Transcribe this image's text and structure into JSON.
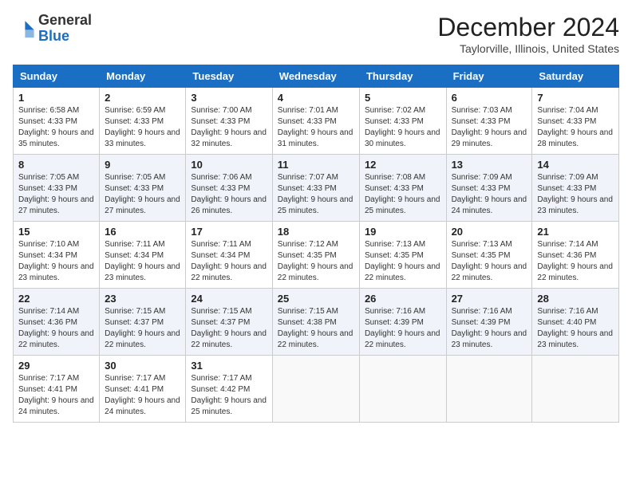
{
  "header": {
    "logo_general": "General",
    "logo_blue": "Blue",
    "month_title": "December 2024",
    "location": "Taylorville, Illinois, United States"
  },
  "days_of_week": [
    "Sunday",
    "Monday",
    "Tuesday",
    "Wednesday",
    "Thursday",
    "Friday",
    "Saturday"
  ],
  "weeks": [
    [
      {
        "day": "1",
        "sunrise": "6:58 AM",
        "sunset": "4:33 PM",
        "daylight": "9 hours and 35 minutes."
      },
      {
        "day": "2",
        "sunrise": "6:59 AM",
        "sunset": "4:33 PM",
        "daylight": "9 hours and 33 minutes."
      },
      {
        "day": "3",
        "sunrise": "7:00 AM",
        "sunset": "4:33 PM",
        "daylight": "9 hours and 32 minutes."
      },
      {
        "day": "4",
        "sunrise": "7:01 AM",
        "sunset": "4:33 PM",
        "daylight": "9 hours and 31 minutes."
      },
      {
        "day": "5",
        "sunrise": "7:02 AM",
        "sunset": "4:33 PM",
        "daylight": "9 hours and 30 minutes."
      },
      {
        "day": "6",
        "sunrise": "7:03 AM",
        "sunset": "4:33 PM",
        "daylight": "9 hours and 29 minutes."
      },
      {
        "day": "7",
        "sunrise": "7:04 AM",
        "sunset": "4:33 PM",
        "daylight": "9 hours and 28 minutes."
      }
    ],
    [
      {
        "day": "8",
        "sunrise": "7:05 AM",
        "sunset": "4:33 PM",
        "daylight": "9 hours and 27 minutes."
      },
      {
        "day": "9",
        "sunrise": "7:05 AM",
        "sunset": "4:33 PM",
        "daylight": "9 hours and 27 minutes."
      },
      {
        "day": "10",
        "sunrise": "7:06 AM",
        "sunset": "4:33 PM",
        "daylight": "9 hours and 26 minutes."
      },
      {
        "day": "11",
        "sunrise": "7:07 AM",
        "sunset": "4:33 PM",
        "daylight": "9 hours and 25 minutes."
      },
      {
        "day": "12",
        "sunrise": "7:08 AM",
        "sunset": "4:33 PM",
        "daylight": "9 hours and 25 minutes."
      },
      {
        "day": "13",
        "sunrise": "7:09 AM",
        "sunset": "4:33 PM",
        "daylight": "9 hours and 24 minutes."
      },
      {
        "day": "14",
        "sunrise": "7:09 AM",
        "sunset": "4:33 PM",
        "daylight": "9 hours and 23 minutes."
      }
    ],
    [
      {
        "day": "15",
        "sunrise": "7:10 AM",
        "sunset": "4:34 PM",
        "daylight": "9 hours and 23 minutes."
      },
      {
        "day": "16",
        "sunrise": "7:11 AM",
        "sunset": "4:34 PM",
        "daylight": "9 hours and 23 minutes."
      },
      {
        "day": "17",
        "sunrise": "7:11 AM",
        "sunset": "4:34 PM",
        "daylight": "9 hours and 22 minutes."
      },
      {
        "day": "18",
        "sunrise": "7:12 AM",
        "sunset": "4:35 PM",
        "daylight": "9 hours and 22 minutes."
      },
      {
        "day": "19",
        "sunrise": "7:13 AM",
        "sunset": "4:35 PM",
        "daylight": "9 hours and 22 minutes."
      },
      {
        "day": "20",
        "sunrise": "7:13 AM",
        "sunset": "4:35 PM",
        "daylight": "9 hours and 22 minutes."
      },
      {
        "day": "21",
        "sunrise": "7:14 AM",
        "sunset": "4:36 PM",
        "daylight": "9 hours and 22 minutes."
      }
    ],
    [
      {
        "day": "22",
        "sunrise": "7:14 AM",
        "sunset": "4:36 PM",
        "daylight": "9 hours and 22 minutes."
      },
      {
        "day": "23",
        "sunrise": "7:15 AM",
        "sunset": "4:37 PM",
        "daylight": "9 hours and 22 minutes."
      },
      {
        "day": "24",
        "sunrise": "7:15 AM",
        "sunset": "4:37 PM",
        "daylight": "9 hours and 22 minutes."
      },
      {
        "day": "25",
        "sunrise": "7:15 AM",
        "sunset": "4:38 PM",
        "daylight": "9 hours and 22 minutes."
      },
      {
        "day": "26",
        "sunrise": "7:16 AM",
        "sunset": "4:39 PM",
        "daylight": "9 hours and 22 minutes."
      },
      {
        "day": "27",
        "sunrise": "7:16 AM",
        "sunset": "4:39 PM",
        "daylight": "9 hours and 23 minutes."
      },
      {
        "day": "28",
        "sunrise": "7:16 AM",
        "sunset": "4:40 PM",
        "daylight": "9 hours and 23 minutes."
      }
    ],
    [
      {
        "day": "29",
        "sunrise": "7:17 AM",
        "sunset": "4:41 PM",
        "daylight": "9 hours and 24 minutes."
      },
      {
        "day": "30",
        "sunrise": "7:17 AM",
        "sunset": "4:41 PM",
        "daylight": "9 hours and 24 minutes."
      },
      {
        "day": "31",
        "sunrise": "7:17 AM",
        "sunset": "4:42 PM",
        "daylight": "9 hours and 25 minutes."
      },
      null,
      null,
      null,
      null
    ]
  ],
  "labels": {
    "sunrise": "Sunrise:",
    "sunset": "Sunset:",
    "daylight": "Daylight:"
  }
}
